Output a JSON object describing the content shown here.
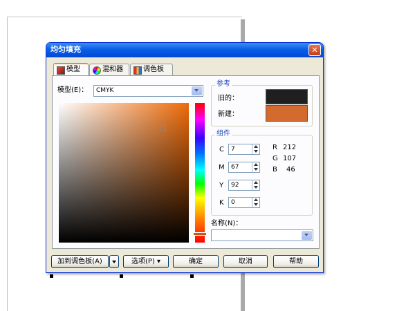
{
  "dialog": {
    "title": "均匀填充",
    "close_glyph": "✕"
  },
  "tabs": [
    {
      "label": "模型",
      "icon": "model-icon",
      "active": true
    },
    {
      "label": "混和器",
      "icon": "mixer-icon",
      "active": false
    },
    {
      "label": "调色板",
      "icon": "palette-icon",
      "active": false
    }
  ],
  "model": {
    "label": "模型(E)：",
    "value": "CMYK"
  },
  "reference": {
    "title": "参考",
    "old_label": "旧的：",
    "new_label": "新建：",
    "old_color": "#1f1f1f",
    "new_color": "#d46b2e"
  },
  "components": {
    "title": "组件",
    "cmyk": [
      {
        "label": "C",
        "value": "7"
      },
      {
        "label": "M",
        "value": "67"
      },
      {
        "label": "Y",
        "value": "92"
      },
      {
        "label": "K",
        "value": "0"
      }
    ],
    "rgb": [
      {
        "label": "R",
        "value": "212"
      },
      {
        "label": "G",
        "value": "107"
      },
      {
        "label": "B",
        "value": "46"
      }
    ]
  },
  "name_field": {
    "label": "名称(N)：",
    "value": ""
  },
  "buttons": {
    "add_palette": "加到调色板(A)",
    "options": "选项(P) ▾",
    "ok": "确定",
    "cancel": "取消",
    "help": "帮助"
  }
}
